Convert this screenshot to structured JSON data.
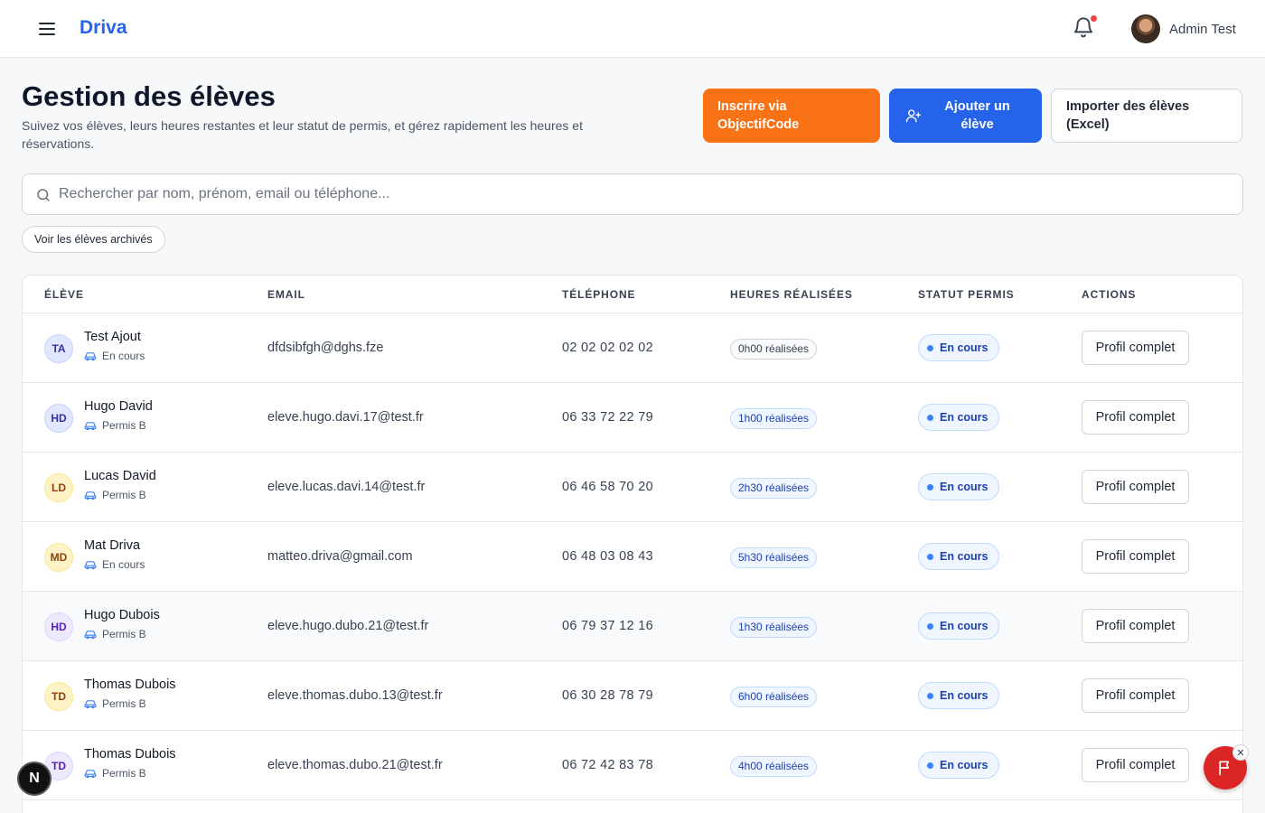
{
  "header": {
    "brand": "Driva",
    "user_name": "Admin Test"
  },
  "page": {
    "title": "Gestion des élèves",
    "subtitle": "Suivez vos élèves, leurs heures restantes et leur statut de permis, et gérez rapidement les heures et réservations."
  },
  "actions": {
    "objectifcode_line1": "Inscrire via",
    "objectifcode_line2": "ObjectifCode",
    "add_line1": "Ajouter un",
    "add_line2": "élève",
    "import_line1": "Importer des élèves",
    "import_line2": "(Excel)"
  },
  "search": {
    "placeholder": "Rechercher par nom, prénom, email ou téléphone..."
  },
  "archived_label": "Voir les élèves archivés",
  "table": {
    "columns": {
      "eleve": "Élève",
      "email": "Email",
      "telephone": "Téléphone",
      "heures": "Heures réalisées",
      "statut": "Statut permis",
      "actions": "Actions"
    },
    "rows": [
      {
        "initials": "TA",
        "name": "Test Ajout",
        "sub": "En cours",
        "email": "dfdsibfgh@dghs.fze",
        "phone": "02 02 02 02 02",
        "hours": "0h00 réalisées",
        "status": "En cours",
        "action": "Profil complet"
      },
      {
        "initials": "HD",
        "name": "Hugo David",
        "sub": "Permis B",
        "email": "eleve.hugo.davi.17@test.fr",
        "phone": "06 33 72 22 79",
        "hours": "1h00 réalisées",
        "status": "En cours",
        "action": "Profil complet"
      },
      {
        "initials": "LD",
        "name": "Lucas David",
        "sub": "Permis B",
        "email": "eleve.lucas.davi.14@test.fr",
        "phone": "06 46 58 70 20",
        "hours": "2h30 réalisées",
        "status": "En cours",
        "action": "Profil complet"
      },
      {
        "initials": "MD",
        "name": "Mat Driva",
        "sub": "En cours",
        "email": "matteo.driva@gmail.com",
        "phone": "06 48 03 08 43",
        "hours": "5h30 réalisées",
        "status": "En cours",
        "action": "Profil complet"
      },
      {
        "initials": "HD",
        "name": "Hugo Dubois",
        "sub": "Permis B",
        "email": "eleve.hugo.dubo.21@test.fr",
        "phone": "06 79 37 12 16",
        "hours": "1h30 réalisées",
        "status": "En cours",
        "action": "Profil complet"
      },
      {
        "initials": "TD",
        "name": "Thomas Dubois",
        "sub": "Permis B",
        "email": "eleve.thomas.dubo.13@test.fr",
        "phone": "06 30 28 78 79",
        "hours": "6h00 réalisées",
        "status": "En cours",
        "action": "Profil complet"
      },
      {
        "initials": "TD",
        "name": "Thomas Dubois",
        "sub": "Permis B",
        "email": "eleve.thomas.dubo.21@test.fr",
        "phone": "06 72 42 83 78",
        "hours": "4h00 réalisées",
        "status": "En cours",
        "action": "Profil complet"
      }
    ]
  },
  "next_badge": "N",
  "colors": {
    "brand": "#2563eb",
    "orange": "#f97316",
    "danger": "#dc2626",
    "status_blue": "#1e40af"
  }
}
